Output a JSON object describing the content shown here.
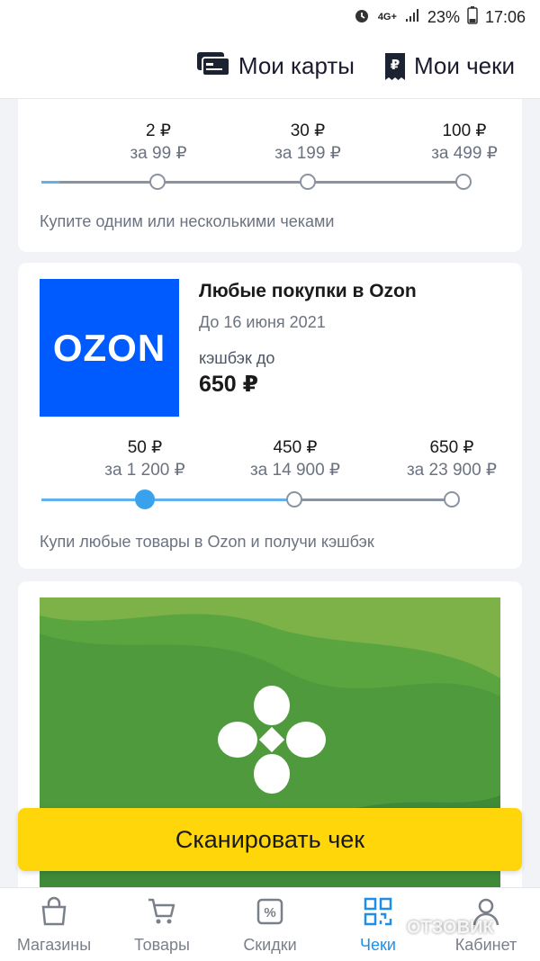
{
  "status_bar": {
    "network": "4G+",
    "battery": "23%",
    "time": "17:06"
  },
  "header": {
    "my_cards": "Мои карты",
    "my_receipts": "Мои чеки",
    "receipt_icon_glyph": "₽"
  },
  "card1": {
    "tiers": [
      {
        "amount": "2 ₽",
        "condition": "за 99 ₽"
      },
      {
        "amount": "30 ₽",
        "condition": "за 199 ₽"
      },
      {
        "amount": "100 ₽",
        "condition": "за 499 ₽"
      }
    ],
    "hint": "Купите одним или несколькими чеками"
  },
  "card2": {
    "logo_text": "OZON",
    "title": "Любые покупки в Ozon",
    "date": "До 16 июня 2021",
    "cashback_label": "кэшбэк до",
    "cashback_value": "650 ₽",
    "tiers": [
      {
        "amount": "50 ₽",
        "condition": "за 1 200 ₽"
      },
      {
        "amount": "450 ₽",
        "condition": "за 14 900 ₽"
      },
      {
        "amount": "650 ₽",
        "condition": "за 23 900 ₽"
      }
    ],
    "hint": "Купи любые товары в Ozon и получи кэшбэк"
  },
  "scan_button": "Сканировать чек",
  "bottom_nav": [
    {
      "label": "Магазины"
    },
    {
      "label": "Товары"
    },
    {
      "label": "Скидки"
    },
    {
      "label": "Чеки"
    },
    {
      "label": "Кабинет"
    }
  ],
  "watermark": "ОТЗОВИК",
  "colors": {
    "accent": "#1f8ee8",
    "scan_button": "#ffd60a",
    "ozon_blue": "#005bff"
  }
}
